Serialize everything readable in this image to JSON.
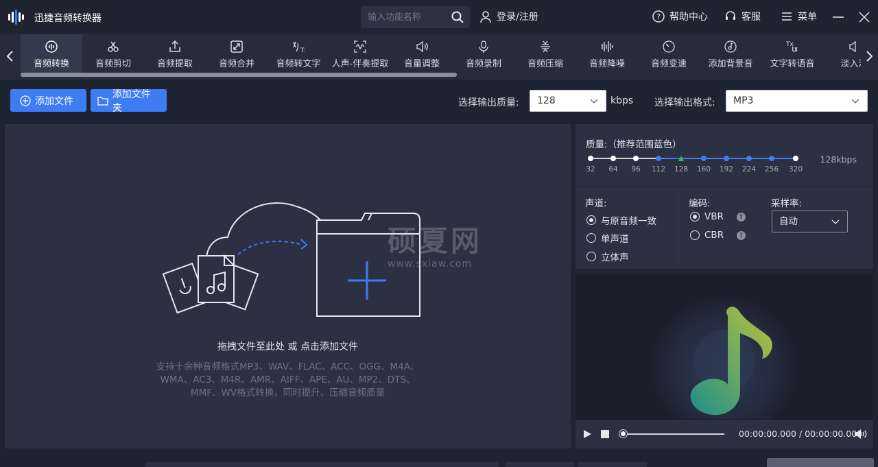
{
  "app": {
    "title": "迅捷音频转换器"
  },
  "search": {
    "placeholder": "输入功能名称"
  },
  "header": {
    "login": "登录/注册",
    "help": "帮助中心",
    "service": "客服",
    "menu": "菜单"
  },
  "tools": [
    {
      "label": "音频转换",
      "icon": "audio-convert-icon"
    },
    {
      "label": "音频剪切",
      "icon": "scissors-icon"
    },
    {
      "label": "音频提取",
      "icon": "upload-icon"
    },
    {
      "label": "音频合并",
      "icon": "merge-icon"
    },
    {
      "label": "音频转文字",
      "icon": "speech-to-text-icon"
    },
    {
      "label": "人声-伴奏提取",
      "icon": "vocal-extract-icon"
    },
    {
      "label": "音量调整",
      "icon": "volume-icon"
    },
    {
      "label": "音频录制",
      "icon": "microphone-icon"
    },
    {
      "label": "音频压缩",
      "icon": "compress-icon"
    },
    {
      "label": "音频降噪",
      "icon": "denoise-icon"
    },
    {
      "label": "音频变速",
      "icon": "speed-icon"
    },
    {
      "label": "添加背景音",
      "icon": "music-disc-icon"
    },
    {
      "label": "文字转语音",
      "icon": "text-to-speech-icon"
    },
    {
      "label": "淡入淡",
      "icon": "fade-icon"
    }
  ],
  "actions": {
    "add_file": "添加文件",
    "add_folder": "添加文件夹",
    "quality_label": "选择输出质量:",
    "quality_value": "128",
    "quality_unit": "kbps",
    "format_label": "选择输出格式:",
    "format_value": "MP3"
  },
  "drop": {
    "title": "拖拽文件至此处 或 点击添加文件",
    "line1": "支持十余种音频格式MP3、WAV、FLAC、ACC、OGG、M4A、",
    "line2": "WMA、AC3、M4R、AMR、AIFF、APE、AU、MP2、DTS、",
    "line3": "MMF、WV格式转换，同时提升、压缩音频质量"
  },
  "quality": {
    "title": "质量:（推荐范围蓝色）",
    "ticks": [
      "32",
      "64",
      "96",
      "112",
      "128",
      "160",
      "192",
      "224",
      "256",
      "320"
    ],
    "current": "128kbps"
  },
  "options": {
    "channel_title": "声道:",
    "channel_opts": [
      "与原音频一致",
      "单声道",
      "立体声"
    ],
    "codec_title": "编码:",
    "codec_opts": [
      "VBR",
      "CBR"
    ],
    "samplerate_title": "采样率:",
    "samplerate_value": "自动"
  },
  "player": {
    "timecode": "00:00:00.000 / 00:00:00.000"
  },
  "watermark": {
    "main": "硕夏网",
    "sub": "www.sxiaw.com"
  },
  "colors": {
    "accent": "#3d7cf5",
    "bg": "#1f2433",
    "panel": "#2b3042",
    "marker": "#2fbf4a"
  }
}
